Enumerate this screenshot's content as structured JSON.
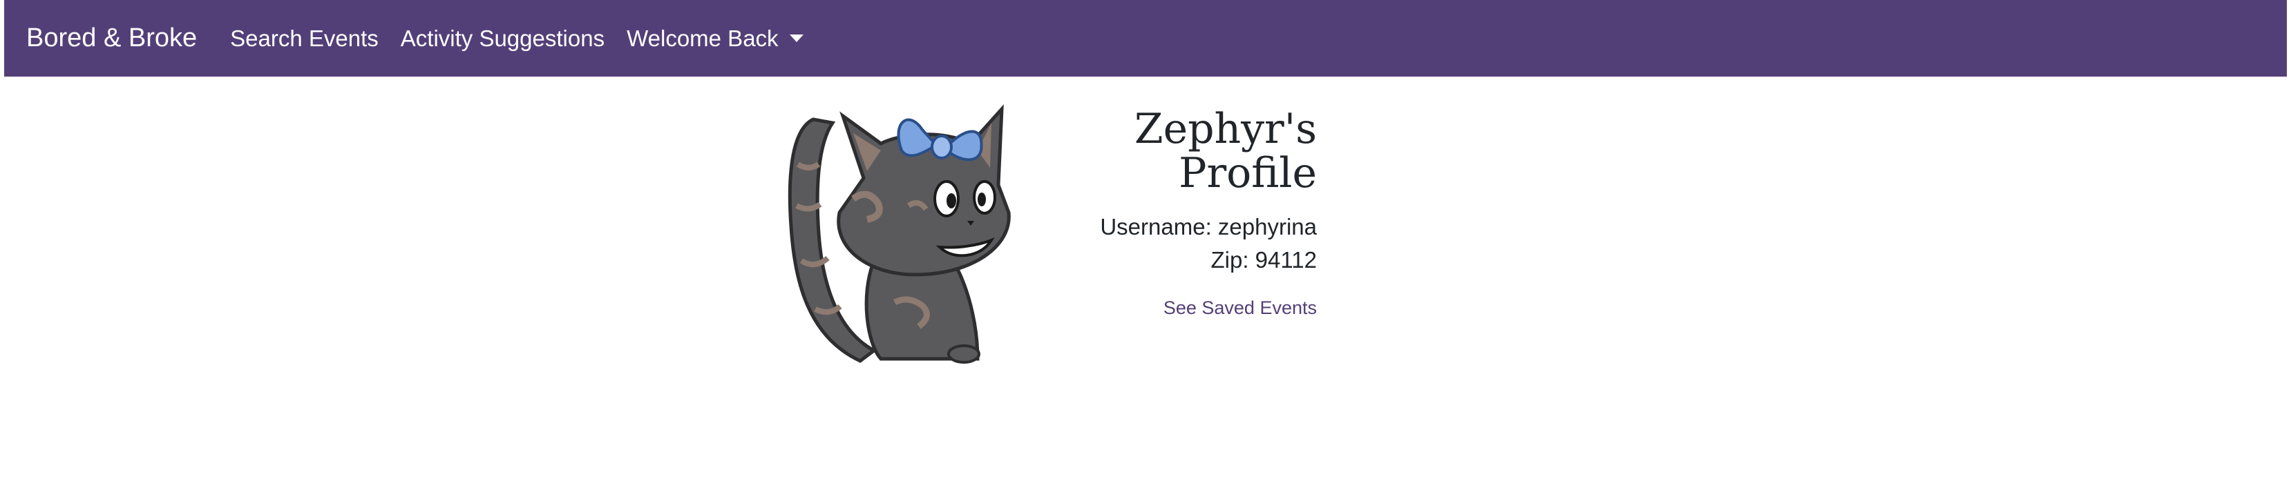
{
  "navbar": {
    "brand": "Bored & Broke",
    "links": {
      "search_events": "Search Events",
      "activity_suggestions": "Activity Suggestions",
      "welcome": "Welcome Back"
    },
    "background_color": "#533f78"
  },
  "profile": {
    "title_line1": "Zephyr's",
    "title_line2": "Profile",
    "username_label": "Username:",
    "username": "zephyrina",
    "zip_label": "Zip:",
    "zip": "94112",
    "saved_events_link": "See Saved Events",
    "avatar_description": "cartoon-tortoiseshell-cat-with-blue-bow"
  }
}
